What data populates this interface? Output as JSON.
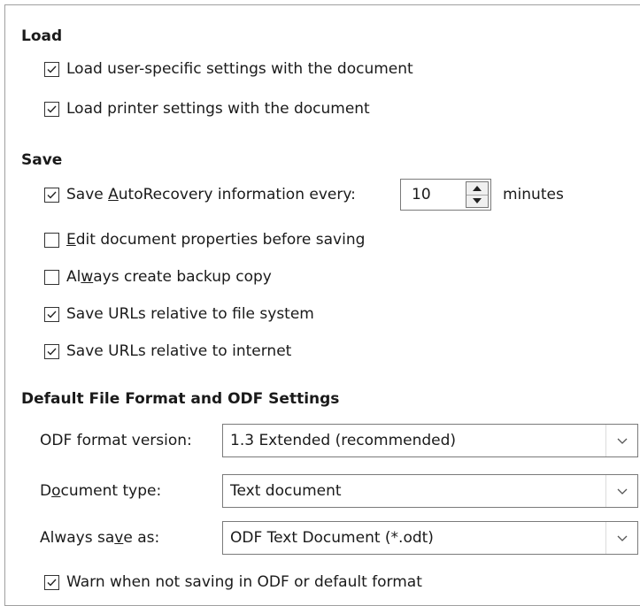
{
  "sections": {
    "load": {
      "title": "Load",
      "user_settings": {
        "label": "Load user-specific settings with the document",
        "checked": true
      },
      "printer_settings": {
        "label": "Load printer settings with the document",
        "checked": true
      }
    },
    "save": {
      "title": "Save",
      "autorecovery": {
        "label_pre": "Save ",
        "label_ul": "A",
        "label_post": "utoRecovery information every:",
        "checked": true,
        "value": "10",
        "unit": "minutes"
      },
      "edit_props": {
        "label_pre": "",
        "label_ul": "E",
        "label_post": "dit document properties before saving",
        "checked": false
      },
      "backup": {
        "label_pre": "Al",
        "label_ul": "w",
        "label_post": "ays create backup copy",
        "checked": false
      },
      "urls_fs": {
        "label": "Save URLs relative to file system",
        "checked": true
      },
      "urls_inet": {
        "label": "Save URLs relative to internet",
        "checked": true
      }
    },
    "defaults": {
      "title": "Default File Format and ODF Settings",
      "odf_version": {
        "label": "ODF format version:",
        "value": "1.3 Extended (recommended)"
      },
      "doc_type": {
        "label_pre": "D",
        "label_ul": "o",
        "label_post": "cument type:",
        "value": "Text document"
      },
      "save_as": {
        "label_pre": "Always sa",
        "label_ul": "v",
        "label_post": "e as:",
        "value": "ODF Text Document (*.odt)"
      },
      "warn": {
        "label": "Warn when not saving in ODF or default format",
        "checked": true
      }
    }
  },
  "icons": {
    "check": "check-icon",
    "spin_up": "triangle-up-icon",
    "spin_down": "triangle-down-icon",
    "dropdown": "chevron-down-icon"
  }
}
